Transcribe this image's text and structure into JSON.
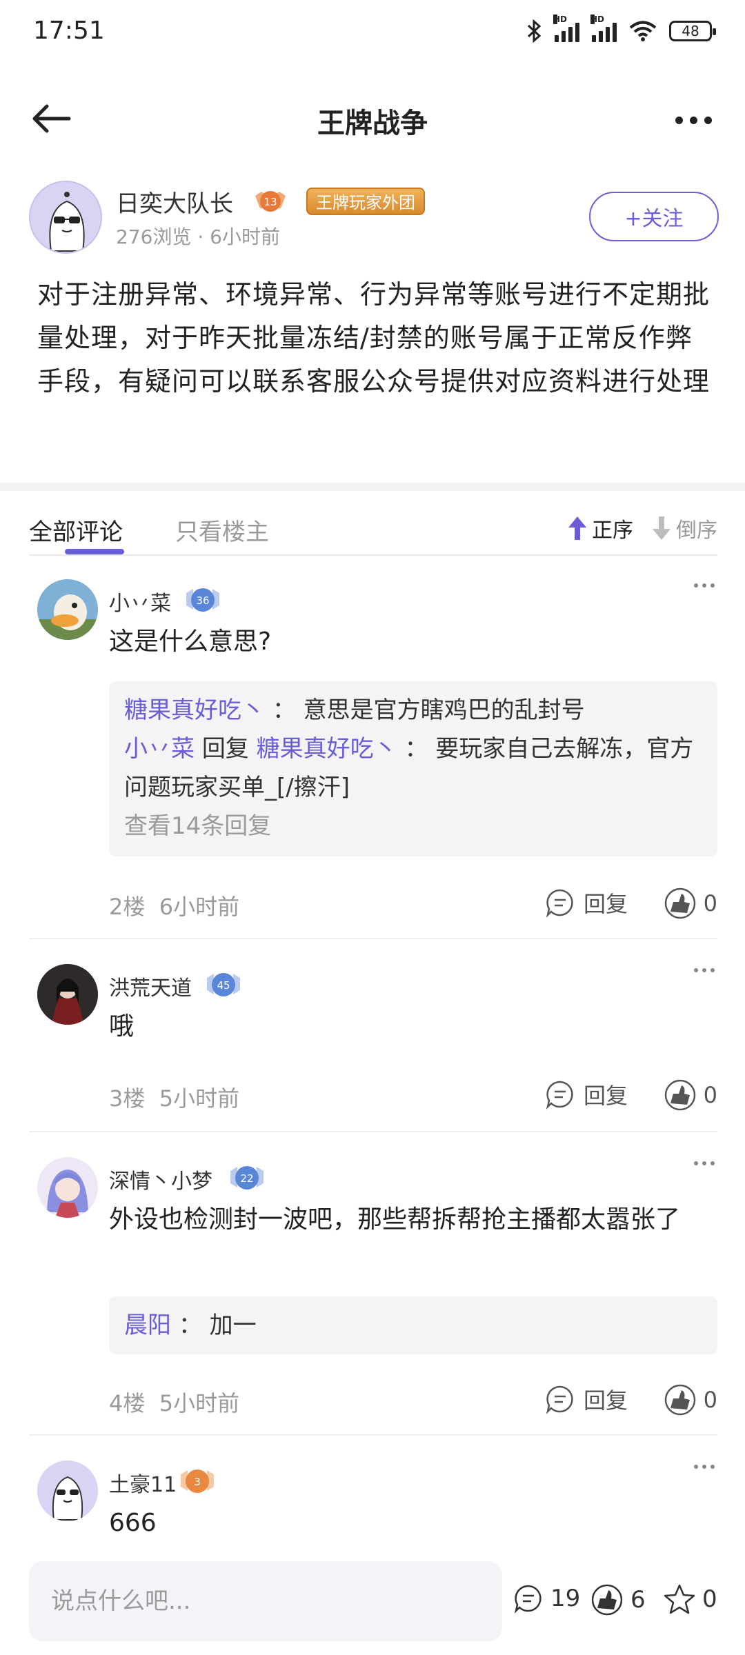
{
  "status": {
    "time": "17:51",
    "battery": "48",
    "hd1": "HD",
    "hd2": "HD"
  },
  "nav": {
    "title": "王牌战争"
  },
  "author": {
    "name": "日奕大队长",
    "level": "13",
    "tag": "王牌玩家外团",
    "views": "276浏览",
    "dot": "·",
    "time": "6小时前",
    "follow_label": "+关注"
  },
  "post": {
    "content": "对于注册异常、环境异常、行为异常等账号进行不定期批量处理，对于昨天批量冻结/封禁的账号属于正常反作弊手段，有疑问可以联系客服公众号提供对应资料进行处理"
  },
  "tabs": {
    "all": "全部评论",
    "host_only": "只看楼主",
    "sort_asc": "正序",
    "sort_desc": "倒序"
  },
  "comments": [
    {
      "name": "小丷菜",
      "level": "36",
      "text": "这是什么意思?",
      "replies": [
        {
          "from": "糖果真好吃丶",
          "sep": "：",
          "text": "意思是官方瞎鸡巴的乱封号"
        },
        {
          "from": "小丷菜",
          "reply_word": "回复",
          "to": "糖果真好吃丶",
          "sep": "：",
          "text": "要玩家自己去解冻，官方问题玩家买单_[/擦汗]"
        }
      ],
      "more_replies": "查看14条回复",
      "floor": "2楼",
      "time": "6小时前",
      "reply_label": "回复",
      "likes": "0"
    },
    {
      "name": "洪荒天道",
      "level": "45",
      "text": "哦",
      "floor": "3楼",
      "time": "5小时前",
      "reply_label": "回复",
      "likes": "0"
    },
    {
      "name": "深情丶小梦",
      "level": "22",
      "text": "外设也检测封一波吧，那些帮拆帮抢主播都太嚣张了",
      "replies": [
        {
          "from": "晨阳",
          "sep": "：",
          "text": "加一"
        }
      ],
      "floor": "4楼",
      "time": "5小时前",
      "reply_label": "回复",
      "likes": "0"
    },
    {
      "name": "土豪11",
      "level": "3",
      "text": "666"
    }
  ],
  "bottom": {
    "placeholder": "说点什么吧...",
    "comments": "19",
    "likes": "6",
    "favorites": "0"
  },
  "colors": {
    "accent": "#6a5ed6",
    "text": "#222222",
    "muted": "#9a9a9a",
    "panel": "#f4f4f6"
  },
  "icons": [
    "bluetooth-icon",
    "signal-icon",
    "wifi-icon",
    "battery-icon",
    "back-arrow-icon",
    "more-icon",
    "level-badge-icon",
    "sort-up-icon",
    "sort-down-icon",
    "comment-icon",
    "like-icon",
    "star-icon"
  ]
}
